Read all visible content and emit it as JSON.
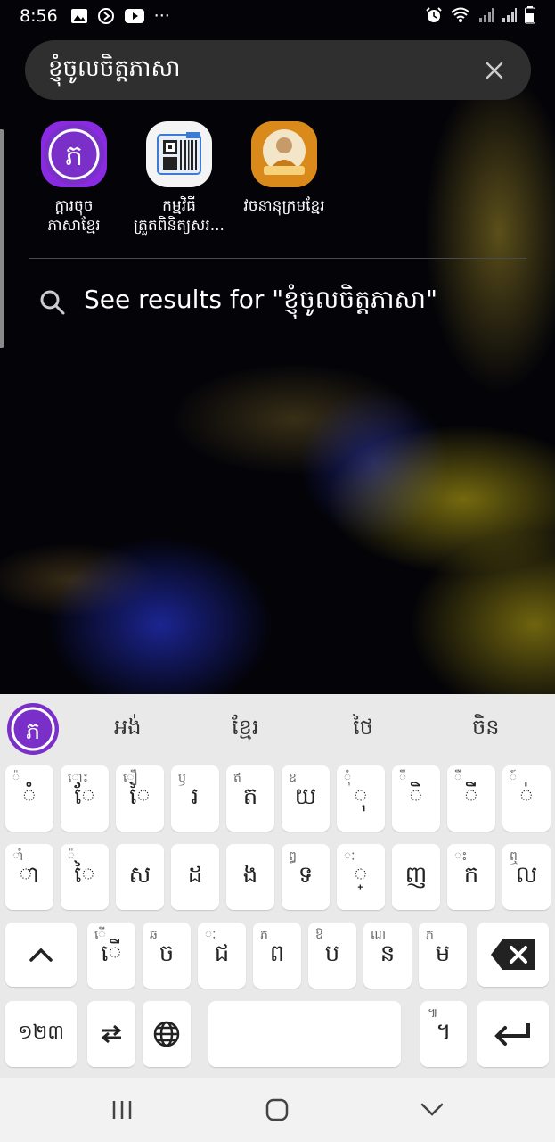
{
  "status_bar": {
    "time": "8:56",
    "more": "···"
  },
  "search": {
    "query": "ខ្ញុំចូលចិត្តភាសា"
  },
  "apps": [
    {
      "label": "ក្ដារចុច\nភាសាខ្មែរ",
      "icon": "khmer-keyboard-icon"
    },
    {
      "label": "កម្មវិធី\nត្រួតពិនិត្យសរ...",
      "icon": "barcode-scanner-icon"
    },
    {
      "label": "វចនានុក្រមខ្មែរ",
      "icon": "monk-portrait-icon"
    }
  ],
  "see_results": "See results for \"ខ្ញុំចូលចិត្តភាសា\"",
  "keyboard": {
    "logo": "ភ",
    "suggestions": [
      "អង់",
      "ខ្មែរ",
      "ថៃ",
      "ចិន"
    ],
    "row1": [
      {
        "main": "ំ",
        "sub": "៉"
      },
      {
        "main": "ែ",
        "sub": "ោះ"
      },
      {
        "main": "ៃ",
        "sub": "ឿ"
      },
      {
        "main": "រ",
        "sub": "ឫ"
      },
      {
        "main": "ត",
        "sub": "ឥ"
      },
      {
        "main": "យ",
        "sub": "ឧ"
      },
      {
        "main": "ុ",
        "sub": "ុំ"
      },
      {
        "main": "ិ",
        "sub": "ឹ"
      },
      {
        "main": "ី",
        "sub": "ឺ"
      },
      {
        "main": "់",
        "sub": "៍"
      }
    ],
    "row2": [
      {
        "main": "ា",
        "sub": "ាំ"
      },
      {
        "main": "ៃ",
        "sub": "៉"
      },
      {
        "main": "ស",
        "sub": ""
      },
      {
        "main": "ដ",
        "sub": ""
      },
      {
        "main": "ង",
        "sub": ""
      },
      {
        "main": "ទ",
        "sub": "ឰ"
      },
      {
        "main": "្",
        "sub": "ៈ"
      },
      {
        "main": "ញ",
        "sub": ""
      },
      {
        "main": "ក",
        "sub": "ះ"
      },
      {
        "main": "ល",
        "sub": "ឮ"
      }
    ],
    "row3": [
      {
        "main": "ើ",
        "sub": "ើ"
      },
      {
        "main": "ច",
        "sub": "ឆ"
      },
      {
        "main": "ជ",
        "sub": "ៈ"
      },
      {
        "main": "ព",
        "sub": "ភ"
      },
      {
        "main": "ប",
        "sub": "ឱ"
      },
      {
        "main": "ន",
        "sub": "ណ"
      },
      {
        "main": "ម",
        "sub": "ភ"
      }
    ],
    "num_key": "១២៣",
    "period_key": {
      "main": "។",
      "sub": "៕"
    }
  }
}
